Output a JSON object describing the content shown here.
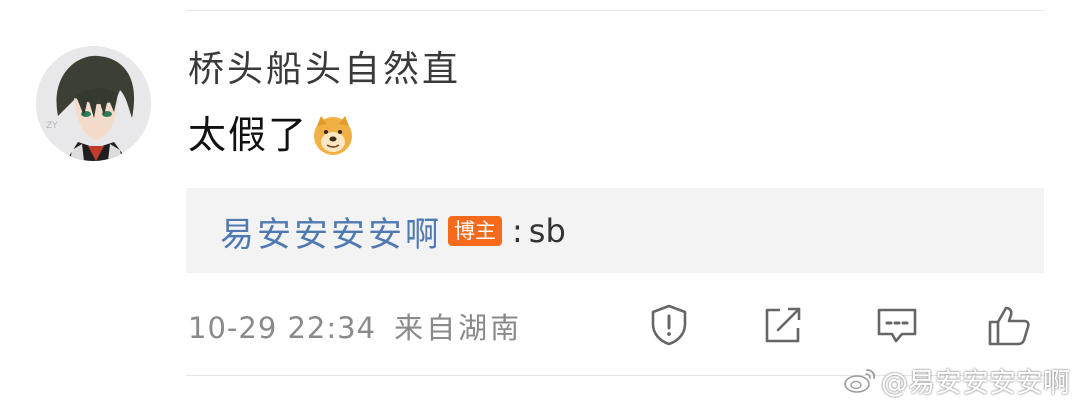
{
  "comment": {
    "username": "桥头船头自然直",
    "text": "太假了",
    "emoji": "doge-emoji"
  },
  "reply": {
    "author": "易安安安安啊",
    "badge": "博主",
    "colon": ":",
    "text": "sb"
  },
  "meta": {
    "time": "10-29 22:34",
    "source": "来自湖南"
  },
  "actions": {
    "report_icon": "shield-alert-icon",
    "share_icon": "share-icon",
    "reply_icon": "comment-icon",
    "like_icon": "thumbs-up-icon"
  },
  "watermark": {
    "text": "@易安安安安啊"
  },
  "colors": {
    "reply_name": "#4f79b1",
    "badge": "#f56a1b",
    "reply_bg": "#f3f3f4"
  }
}
